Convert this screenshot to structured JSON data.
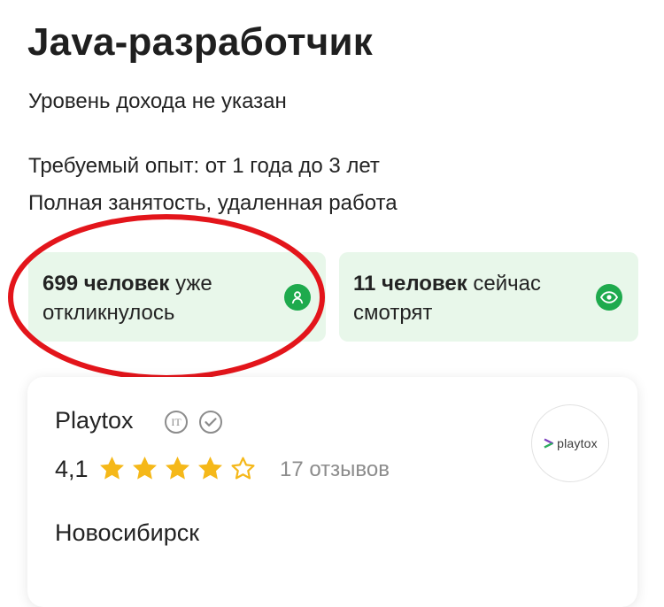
{
  "vacancy": {
    "title": "Java-разработчик",
    "salary": "Уровень дохода не указан",
    "experience": "Требуемый опыт: от 1 года до 3 лет",
    "employment": "Полная занятость, удаленная работа"
  },
  "stats": {
    "responses": {
      "count": "699 человек",
      "text": "уже откликнулось",
      "icon": "person-icon"
    },
    "viewing": {
      "count": "11 человек",
      "text": "сейчас смотрят",
      "icon": "eye-icon"
    }
  },
  "company": {
    "name": "Playtox",
    "it_badge": "IT",
    "rating": "4,1",
    "stars_filled": 4,
    "stars_total": 5,
    "reviews": "17 отзывов",
    "city": "Новосибирск",
    "logo_text": "playtox"
  },
  "colors": {
    "accent_green": "#1eaa4d",
    "stat_background": "#e8f7ea",
    "star_yellow": "#f5b819",
    "highlight_red": "#e3151b"
  }
}
